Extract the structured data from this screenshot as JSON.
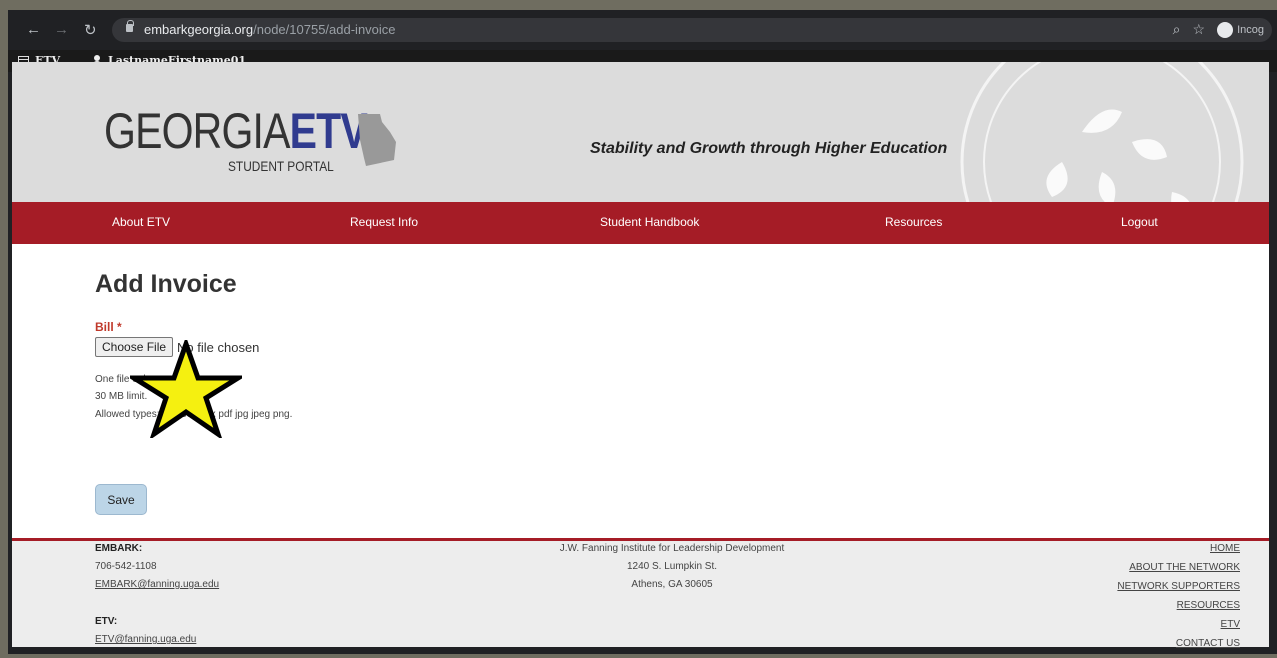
{
  "browser": {
    "url_domain": "embarkgeorgia.org",
    "url_path": "/node/10755/add-invoice",
    "profile_label": "Incog"
  },
  "admin_bar": {
    "home_label": "ETV",
    "user_label": "LastnameFirstname01"
  },
  "header": {
    "logo_georgia": "GEORGIA",
    "logo_etv": "ETV",
    "logo_sub": "STUDENT PORTAL",
    "tagline": "Stability and Growth through Higher Education"
  },
  "nav": {
    "items": [
      {
        "label": "About ETV"
      },
      {
        "label": "Request Info"
      },
      {
        "label": "Student Handbook"
      },
      {
        "label": "Resources"
      },
      {
        "label": "Logout"
      }
    ]
  },
  "form": {
    "title": "Add Invoice",
    "field_label": "Bill *",
    "choose_button": "Choose File",
    "no_file_text": "No file chosen",
    "help_lines": [
      "One file only.",
      "30 MB limit.",
      "Allowed types: txt doc docx pdf jpg jpeg png."
    ],
    "save_label": "Save"
  },
  "footer": {
    "embark_heading": "EMBARK:",
    "embark_phone": "706-542-1108",
    "embark_email": "EMBARK@fanning.uga.edu",
    "etv_heading": "ETV:",
    "etv_email": "ETV@fanning.uga.edu",
    "address_lines": [
      "J.W. Fanning Institute for Leadership Development",
      "1240 S. Lumpkin St.",
      "Athens, GA 30605"
    ],
    "links": [
      "HOME",
      "ABOUT THE NETWORK",
      "NETWORK SUPPORTERS",
      "RESOURCES",
      "ETV",
      "CONTACT US"
    ]
  },
  "colors": {
    "nav_red": "#a51c26",
    "etv_blue": "#303b8f",
    "star_yellow": "#f5f010"
  }
}
